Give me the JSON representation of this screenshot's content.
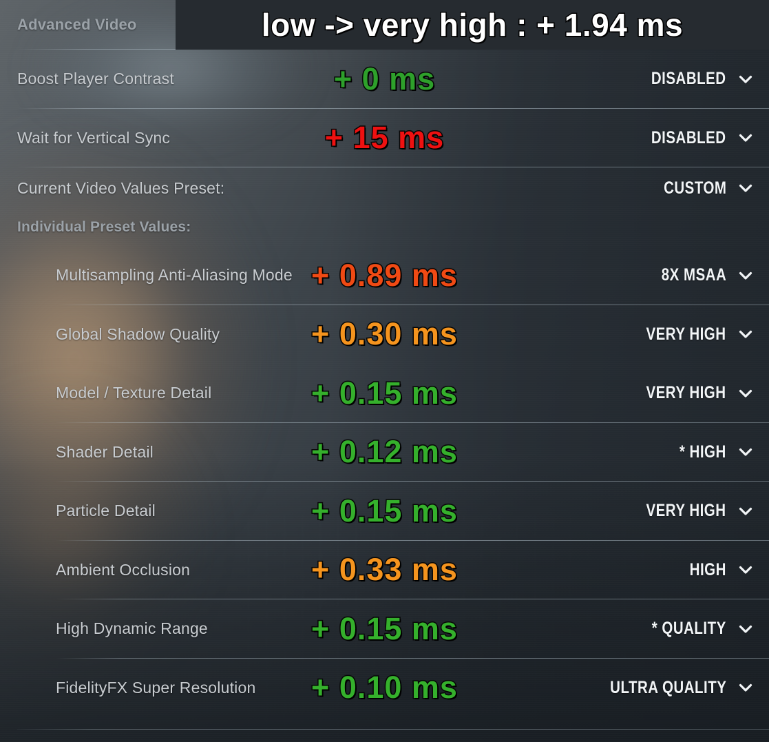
{
  "banner": {
    "text": "low -> very high : + 1.94 ms"
  },
  "header": {
    "title": "Advanced Video"
  },
  "sections": {
    "preset_label": "Current Video Values Preset:",
    "preset_value": "CUSTOM",
    "individual_label": "Individual Preset Values:"
  },
  "colors": {
    "green": "#2ea02b",
    "green_bright": "#35b02c",
    "red": "#ee1111",
    "red_orange": "#f04a14",
    "orange": "#f5941e",
    "label": "#c8ccd0",
    "header_label": "#9ba2a8",
    "value": "#f2f5f7",
    "banner_bg": "#262b30"
  },
  "icons": {
    "chevron": "chevron-down-icon"
  },
  "rows": [
    {
      "name": "boost-player-contrast",
      "label": "Boost Player Contrast",
      "ms": "+ 0 ms",
      "ms_color": "c-green",
      "value": "DISABLED",
      "indent": false
    },
    {
      "name": "wait-for-vertical-sync",
      "label": "Wait for Vertical Sync",
      "ms": "+ 15 ms",
      "ms_color": "c-red",
      "value": "DISABLED",
      "indent": false
    },
    {
      "name": "multisampling-anti-aliasing-mode",
      "label": "Multisampling Anti-Aliasing Mode",
      "ms": "+ 0.89 ms",
      "ms_color": "c-redorange",
      "value": "8X MSAA",
      "indent": true
    },
    {
      "name": "global-shadow-quality",
      "label": "Global Shadow Quality",
      "ms": "+ 0.30 ms",
      "ms_color": "c-orange",
      "value": "VERY HIGH",
      "indent": true
    },
    {
      "name": "model-texture-detail",
      "label": "Model / Texture Detail",
      "ms": "+ 0.15 ms",
      "ms_color": "c-green2",
      "value": "VERY HIGH",
      "indent": true
    },
    {
      "name": "shader-detail",
      "label": "Shader Detail",
      "ms": "+ 0.12 ms",
      "ms_color": "c-green2",
      "value": "* HIGH",
      "indent": true
    },
    {
      "name": "particle-detail",
      "label": "Particle Detail",
      "ms": "+ 0.15 ms",
      "ms_color": "c-green2",
      "value": "VERY HIGH",
      "indent": true
    },
    {
      "name": "ambient-occlusion",
      "label": "Ambient Occlusion",
      "ms": "+ 0.33 ms",
      "ms_color": "c-orange",
      "value": "HIGH",
      "indent": true
    },
    {
      "name": "high-dynamic-range",
      "label": "High Dynamic Range",
      "ms": "+ 0.15 ms",
      "ms_color": "c-green2",
      "value": "* QUALITY",
      "indent": true
    },
    {
      "name": "fidelityfx-super-resolution",
      "label": "FidelityFX Super Resolution",
      "ms": "+ 0.10 ms",
      "ms_color": "c-green2",
      "value": "ULTRA QUALITY",
      "indent": true
    }
  ]
}
